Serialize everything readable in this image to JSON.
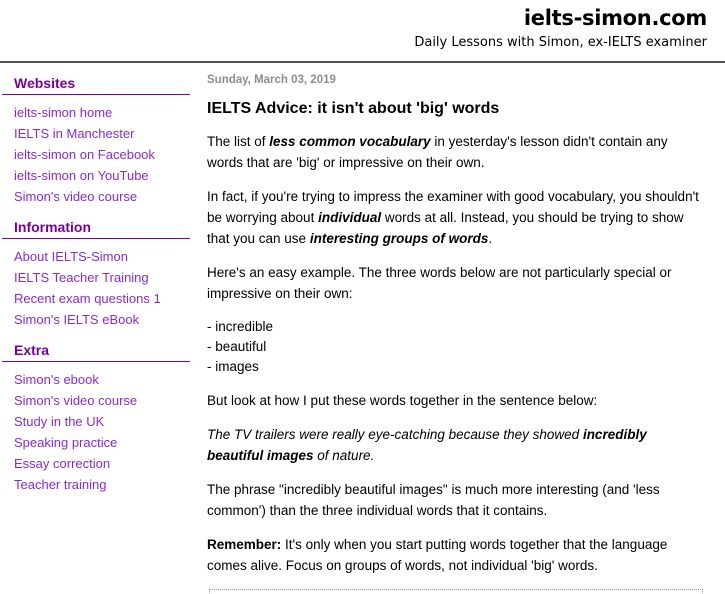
{
  "header": {
    "title": "ielts-simon.com",
    "tagline": "Daily Lessons with Simon, ex-IELTS examiner"
  },
  "sidebar": {
    "sections": [
      {
        "heading": "Websites",
        "links": [
          "ielts-simon home",
          "IELTS in Manchester",
          "ielts-simon on Facebook",
          "ielts-simon on YouTube",
          "Simon's video course"
        ]
      },
      {
        "heading": "Information",
        "links": [
          "About IELTS-Simon",
          "IELTS Teacher Training",
          "Recent exam questions 1",
          "Simon's IELTS eBook"
        ]
      },
      {
        "heading": "Extra",
        "links": [
          "Simon's ebook",
          "Simon's video course",
          "Study in the UK",
          "Speaking practice",
          "Essay correction",
          "Teacher training"
        ]
      }
    ]
  },
  "post": {
    "date": "Sunday, March 03, 2019",
    "title": "IELTS Advice: it isn't about 'big' words",
    "p1_a": "The list of ",
    "p1_b": "less common vocabulary",
    "p1_c": " in yesterday's lesson didn't contain any words that are 'big' or impressive on their own.",
    "p2_a": "In fact, if you're trying to impress the examiner with good vocabulary, you shouldn't be worrying about ",
    "p2_b": "individual",
    "p2_c": " words at all. Instead, you should be trying to show that you can use ",
    "p2_d": "interesting groups of words",
    "p2_e": ".",
    "p3": "Here's an easy example. The three words below are not particularly special or impressive on their own:",
    "list": [
      "- incredible",
      "- beautiful",
      "- images"
    ],
    "p4": "But look at how I put these words together in the sentence below:",
    "p5_a": "The TV trailers were really eye-catching because they showed ",
    "p5_b": "incredibly beautiful images",
    "p5_c": " of nature.",
    "p6": "The phrase \"incredibly beautiful images\" is much more interesting (and 'less common') than the three individual words that it contains.",
    "p7_a": "Remember:",
    "p7_b": " It's only when you start putting words together that the language comes alive. Focus on groups of words, not individual 'big' words."
  },
  "colors": {
    "link": "#8a2ad0",
    "heading": "#7a009a",
    "date": "#8d8d8d",
    "header_rule": "#555555"
  }
}
